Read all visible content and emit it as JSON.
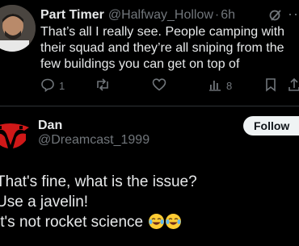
{
  "reply": {
    "author_name": "Part Timer",
    "author_handle": "@Halfway_Hollow",
    "separator": "·",
    "time": "6h",
    "text_lines": [
      "That’s all I really see. People camping with",
      "their squad and they’re all sniping from the",
      "few buildings you can get on top of"
    ],
    "actions": {
      "replies": "1",
      "reposts": "",
      "likes": "",
      "views": "8"
    }
  },
  "post": {
    "author_name": "Dan",
    "author_handle": "@Dreamcast_1999",
    "follow_label": "Follow",
    "text_lines": [
      "That's fine, what is the issue?",
      "Use a javelin!",
      "It's not rocket science"
    ],
    "trailing_emoji": "face-with-tears-of-joy x2"
  },
  "colors": {
    "background": "#000000",
    "text": "#e7e9ea",
    "muted": "#71767b",
    "divider": "#2f3336",
    "follow_bg": "#eff3f4",
    "emoji": "#ffcc33"
  },
  "icons": [
    "grok-icon",
    "more-icon",
    "reply-icon",
    "repost-icon",
    "like-icon",
    "views-icon",
    "bookmark-icon",
    "share-icon",
    "face-with-tears-of-joy-icon"
  ]
}
